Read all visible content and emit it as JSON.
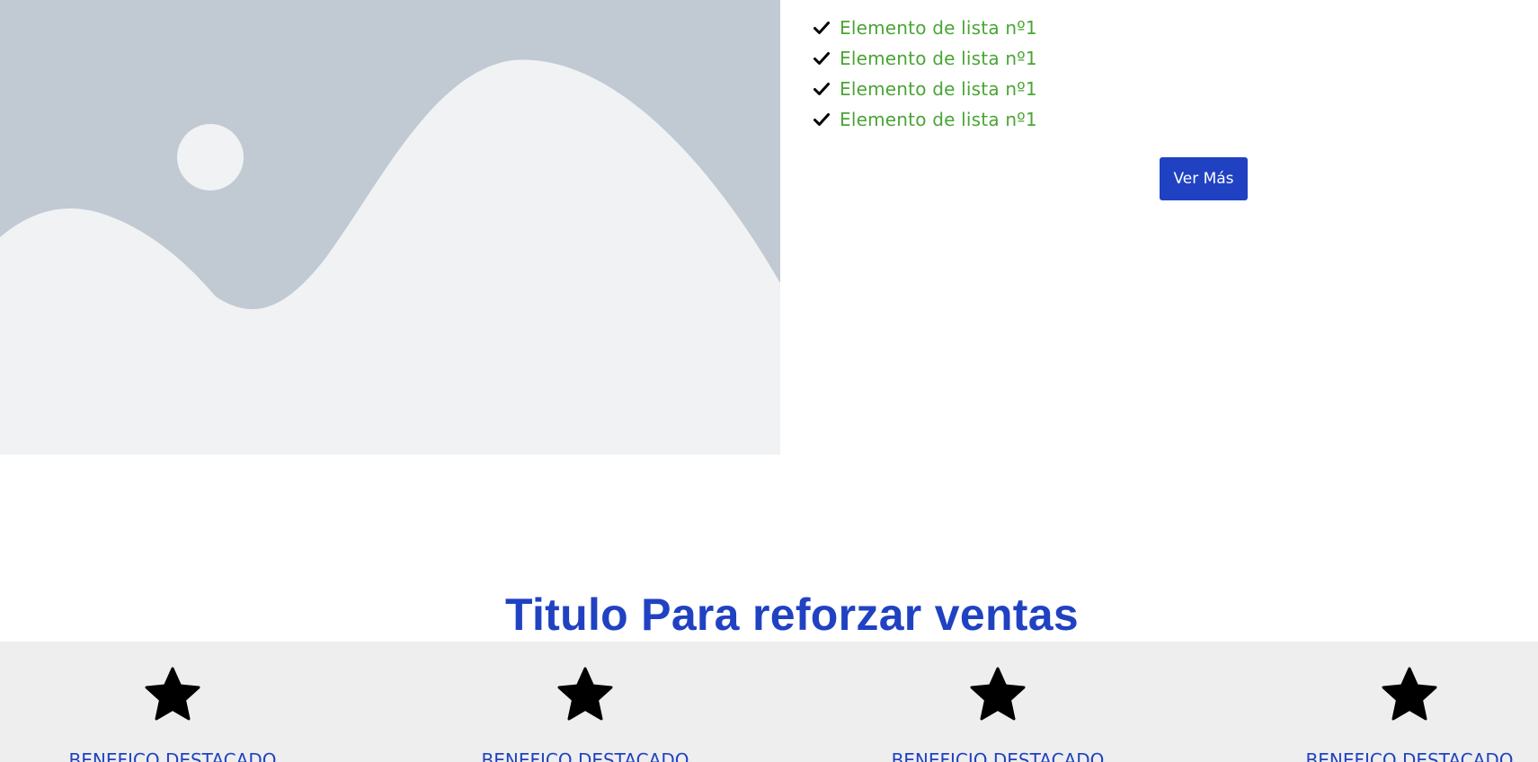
{
  "hero": {
    "image_icon": "image-placeholder-icon",
    "list": {
      "icon": "check-icon",
      "items": [
        "Elemento de lista nº1",
        "Elemento de lista nº1",
        "Elemento de lista nº1",
        "Elemento de lista nº1"
      ]
    },
    "button_label": "Ver Más"
  },
  "sales": {
    "title": "Titulo Para reforzar ventas"
  },
  "benefits": {
    "icon": "star-icon",
    "items": [
      "BENEFICO DESTACADO",
      "BENEFICO DESTACADO",
      "BENEFICIO DESTACADO",
      "BENEFICO DESTACADO"
    ]
  },
  "colors": {
    "accent": "#2042c2",
    "list_text": "#4aa534",
    "band_background": "#eeeeee",
    "placeholder_sky": "#c1cad2",
    "placeholder_ground": "#f0f2f4"
  }
}
